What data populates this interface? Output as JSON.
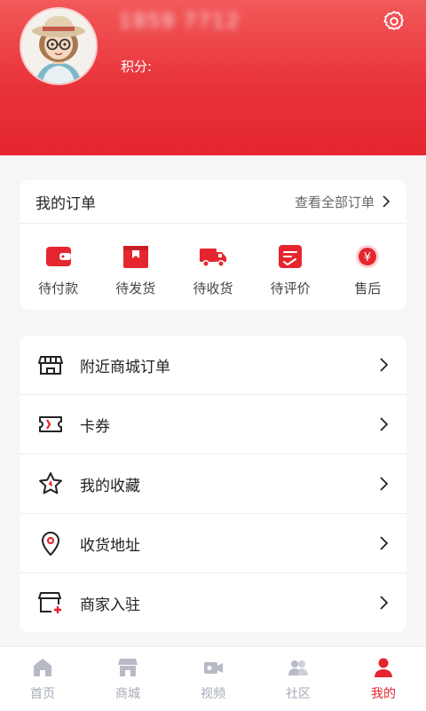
{
  "header": {
    "username": "1859 7712",
    "points_label": "积分:"
  },
  "orders": {
    "title": "我的订单",
    "view_all": "查看全部订单",
    "items": [
      {
        "label": "待付款",
        "icon": "wallet-icon"
      },
      {
        "label": "待发货",
        "icon": "box-icon"
      },
      {
        "label": "待收货",
        "icon": "truck-icon"
      },
      {
        "label": "待评价",
        "icon": "review-icon"
      },
      {
        "label": "售后",
        "icon": "refund-icon"
      }
    ]
  },
  "menu": [
    {
      "label": "附近商城订单",
      "icon": "store-icon"
    },
    {
      "label": "卡券",
      "icon": "ticket-icon"
    },
    {
      "label": "我的收藏",
      "icon": "star-icon"
    },
    {
      "label": "收货地址",
      "icon": "location-pin-icon"
    },
    {
      "label": "商家入驻",
      "icon": "merchant-add-icon"
    }
  ],
  "tabbar": [
    {
      "label": "首页",
      "icon": "home-icon",
      "active": false
    },
    {
      "label": "商城",
      "icon": "shop-icon",
      "active": false
    },
    {
      "label": "视频",
      "icon": "video-icon",
      "active": false
    },
    {
      "label": "社区",
      "icon": "community-icon",
      "active": false
    },
    {
      "label": "我的",
      "icon": "user-icon",
      "active": true
    }
  ],
  "colors": {
    "brand_red": "#e5262f",
    "tab_inactive": "#a6aab8"
  }
}
